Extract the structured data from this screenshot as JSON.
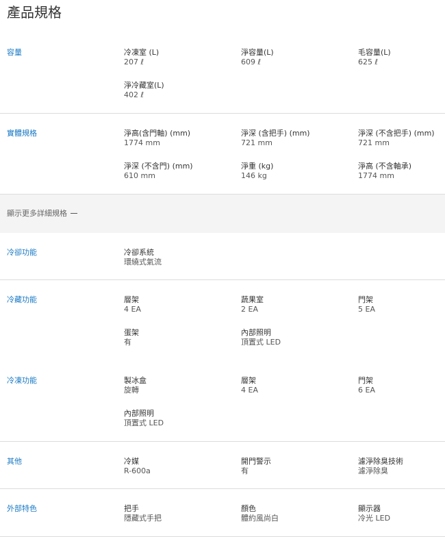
{
  "page_title": "產品規格",
  "more_toggle": {
    "label": "顯示更多詳細規格",
    "icon": "minus-icon"
  },
  "sections": {
    "capacity": {
      "title": "容量",
      "items": [
        {
          "label": "冷凍室 (L)",
          "value": "207 ℓ"
        },
        {
          "label": "淨容量(L)",
          "value": "609 ℓ"
        },
        {
          "label": "毛容量(L)",
          "value": "625 ℓ"
        },
        {
          "label": "淨冷藏室(L)",
          "value": "402 ℓ"
        }
      ]
    },
    "dimensions": {
      "title": "實體規格",
      "items": [
        {
          "label": "淨高(含門軸) (mm)",
          "value": "1774 mm"
        },
        {
          "label": "淨深 (含把手) (mm)",
          "value": "721 mm"
        },
        {
          "label": "淨深 (不含把手) (mm)",
          "value": "721 mm"
        },
        {
          "label": "淨深 (不含門) (mm)",
          "value": "610 mm"
        },
        {
          "label": "淨重 (kg)",
          "value": "146 kg"
        },
        {
          "label": "淨高 (不含軸承)",
          "value": "1774 mm"
        }
      ]
    },
    "cooling": {
      "title": "冷卻功能",
      "items": [
        {
          "label": "冷卻系統",
          "value": "環繞式氣流"
        }
      ]
    },
    "fridge": {
      "title": "冷藏功能",
      "items": [
        {
          "label": "層架",
          "value": "4 EA"
        },
        {
          "label": "蔬果室",
          "value": "2 EA"
        },
        {
          "label": "門架",
          "value": "5 EA"
        },
        {
          "label": "蛋架",
          "value": "有"
        },
        {
          "label": "內部照明",
          "value": "頂置式 LED"
        }
      ]
    },
    "freezer": {
      "title": "冷凍功能",
      "items": [
        {
          "label": "製冰盒",
          "value": "旋轉"
        },
        {
          "label": "層架",
          "value": "4 EA"
        },
        {
          "label": "門架",
          "value": "6 EA"
        },
        {
          "label": "內部照明",
          "value": "頂置式 LED"
        }
      ]
    },
    "other": {
      "title": "其他",
      "items": [
        {
          "label": "冷媒",
          "value": "R-600a"
        },
        {
          "label": "開門警示",
          "value": "有"
        },
        {
          "label": "濾淨除臭技術",
          "value": "濾淨除臭"
        }
      ]
    },
    "exterior": {
      "title": "外部特色",
      "items": [
        {
          "label": "把手",
          "value": "隱藏式手把"
        },
        {
          "label": "顏色",
          "value": "體約風尚白"
        },
        {
          "label": "顯示器",
          "value": "冷光 LED"
        }
      ]
    }
  }
}
